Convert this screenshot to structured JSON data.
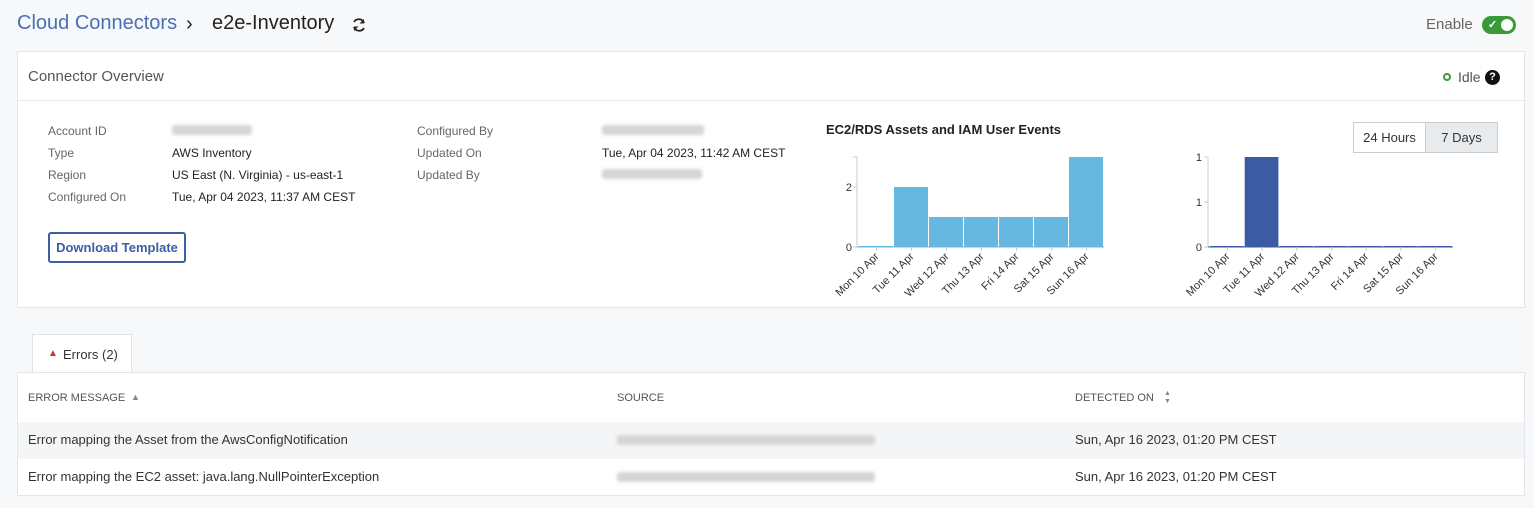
{
  "header": {
    "breadcrumb_root": "Cloud Connectors",
    "breadcrumb_sep": "›",
    "breadcrumb_current": "e2e-Inventory",
    "refresh_icon": "refresh-icon",
    "enable_label": "Enable",
    "enable_on": true
  },
  "overview": {
    "title": "Connector Overview",
    "status": "Idle",
    "help_icon": "question-circle-icon",
    "fields_left": [
      {
        "label": "Account ID",
        "value": ""
      },
      {
        "label": "Type",
        "value": "AWS Inventory"
      },
      {
        "label": "Region",
        "value": "US East (N. Virginia) - us-east-1"
      },
      {
        "label": "Configured On",
        "value": "Tue, Apr 04 2023, 11:37 AM CEST"
      }
    ],
    "fields_right": [
      {
        "label": "Configured By",
        "value": ""
      },
      {
        "label": "Updated On",
        "value": "Tue, Apr 04 2023, 11:42 AM CEST"
      },
      {
        "label": "Updated By",
        "value": ""
      }
    ],
    "download_button": "Download Template",
    "chart_title": "EC2/RDS Assets and IAM User Events",
    "range_buttons": [
      "24 Hours",
      "7 Days"
    ],
    "range_selected": "7 Days"
  },
  "chart_data": [
    {
      "type": "bar",
      "categories": [
        "Mon 10 Apr",
        "Tue 11 Apr",
        "Wed 12 Apr",
        "Thu 13 Apr",
        "Fri 14 Apr",
        "Sat 15 Apr",
        "Sun 16 Apr"
      ],
      "values": [
        0,
        2,
        1,
        1,
        1,
        1,
        3
      ],
      "yticks": [
        "0",
        "2"
      ],
      "ylim": [
        0,
        3
      ],
      "color": "#66b8e0"
    },
    {
      "type": "bar",
      "categories": [
        "Mon 10 Apr",
        "Tue 11 Apr",
        "Wed 12 Apr",
        "Thu 13 Apr",
        "Fri 14 Apr",
        "Sat 15 Apr",
        "Sun 16 Apr"
      ],
      "values": [
        0,
        1,
        0,
        0,
        0,
        0,
        0
      ],
      "yticks": [
        "0",
        "1",
        "1"
      ],
      "ylim": [
        0,
        1
      ],
      "color": "#3b5ba5"
    }
  ],
  "errors_tab": {
    "label": "Errors (2)",
    "icon": "warning-triangle-icon"
  },
  "table": {
    "headers": [
      "ERROR MESSAGE",
      "SOURCE",
      "DETECTED ON"
    ],
    "rows": [
      {
        "message": "Error mapping the Asset from the AwsConfigNotification",
        "source": "",
        "detected": "Sun, Apr 16 2023, 01:20 PM CEST"
      },
      {
        "message": "Error mapping the EC2 asset: java.lang.NullPointerException",
        "source": "",
        "detected": "Sun, Apr 16 2023, 01:20 PM CEST"
      }
    ]
  }
}
